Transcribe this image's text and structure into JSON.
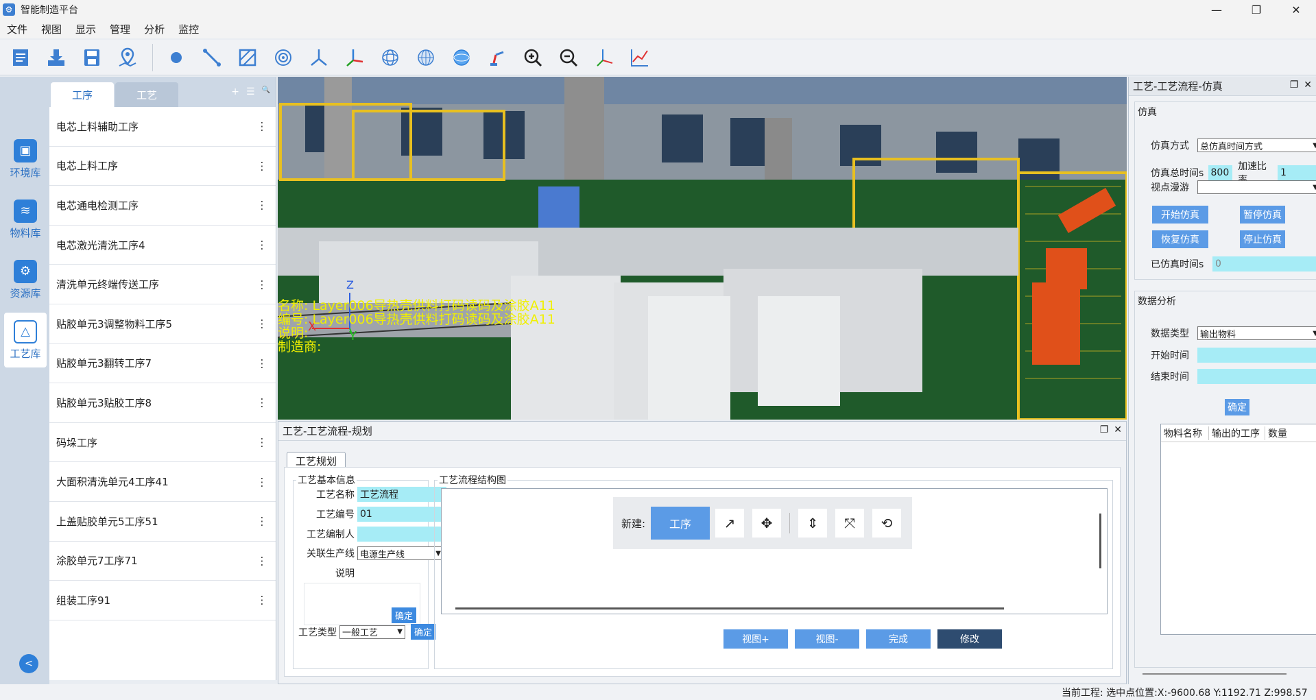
{
  "window": {
    "title": "智能制造平台",
    "controls": [
      "—",
      "❐",
      "✕"
    ]
  },
  "menu": [
    "文件",
    "视图",
    "显示",
    "管理",
    "分析",
    "监控"
  ],
  "toolbar_icons": [
    "open-file-icon",
    "import-icon",
    "save-icon",
    "map-pin-icon",
    "point-icon",
    "line-icon",
    "hatch-icon",
    "circle-target-icon",
    "axis-y-icon",
    "axis-xyz-icon",
    "sphere-wire-icon",
    "sphere-grid-icon",
    "sphere-blue-icon",
    "robot-arm-icon",
    "zoom-in-icon",
    "zoom-out-icon",
    "axes-icon",
    "chart-line-icon"
  ],
  "leftnav": [
    {
      "label": "环境库",
      "icon": "cube-icon"
    },
    {
      "label": "物料库",
      "icon": "layers-icon"
    },
    {
      "label": "资源库",
      "icon": "resource-icon"
    },
    {
      "label": "工艺库",
      "icon": "process-icon"
    }
  ],
  "listpanel": {
    "tabs": [
      "工序",
      "工艺"
    ],
    "tools": [
      "+",
      "☰",
      "🔍"
    ],
    "items": [
      "电芯上料辅助工序",
      "电芯上料工序",
      "电芯通电检测工序",
      "电芯激光清洗工序4",
      "清洗单元终端传送工序",
      "贴胶单元3调整物料工序5",
      "贴胶单元3翻转工序7",
      "贴胶单元3贴胶工序8",
      "码垛工序",
      "大面积清洗单元4工序41",
      "上盖贴胶单元5工序51",
      "涂胶单元7工序71",
      "组装工序91"
    ]
  },
  "viewport": {
    "overlay": [
      "名称: Layer006导热壳供料打码读码及涂胶A11",
      "编号: Layer006导热壳供料打码读码及涂胶A11",
      "说明:",
      "制造商:"
    ],
    "axis_labels": {
      "x": "X",
      "y": "Y",
      "z": "Z"
    }
  },
  "plan": {
    "title": "工艺-工艺流程-规划",
    "subtab": "工艺规划",
    "basic_legend": "工艺基本信息",
    "name_label": "工艺名称",
    "name_value": "工艺流程",
    "code_label": "工艺编号",
    "code_value": "01",
    "author_label": "工艺编制人",
    "author_value": "",
    "line_label": "关联生产线",
    "line_value": "电源生产线",
    "desc_label": "说明",
    "confirm1": "确定",
    "type_label": "工艺类型",
    "type_value": "一般工艺",
    "confirm2": "确定",
    "flow_legend": "工艺流程结构图",
    "new_label": "新建:",
    "process_btn": "工序",
    "buttons": {
      "view_plus": "视图+",
      "view_minus": "视图-",
      "done": "完成",
      "edit": "修改"
    }
  },
  "sim": {
    "title": "工艺-工艺流程-仿真",
    "section": "仿真",
    "mode_label": "仿真方式",
    "mode_value": "总仿真时间方式",
    "total_label": "仿真总时间s",
    "total_value": "800",
    "ratio_label": "加速比率",
    "ratio_value": "1",
    "roam_label": "视点漫游",
    "roam_value": "",
    "start": "开始仿真",
    "pause": "暂停仿真",
    "resume": "恢复仿真",
    "stop": "停止仿真",
    "elapsed_label": "已仿真时间s",
    "elapsed_value": "0",
    "analysis": "数据分析",
    "dtype_label": "数据类型",
    "dtype_value": "输出物料",
    "start_time_label": "开始时间",
    "end_time_label": "结束时间",
    "confirm": "确定",
    "table_headers": [
      "物料名称",
      "输出的工序",
      "数量"
    ]
  },
  "status": "当前工程: 选中点位置:X:-9600.68 Y:1192.71 Z:998.57"
}
